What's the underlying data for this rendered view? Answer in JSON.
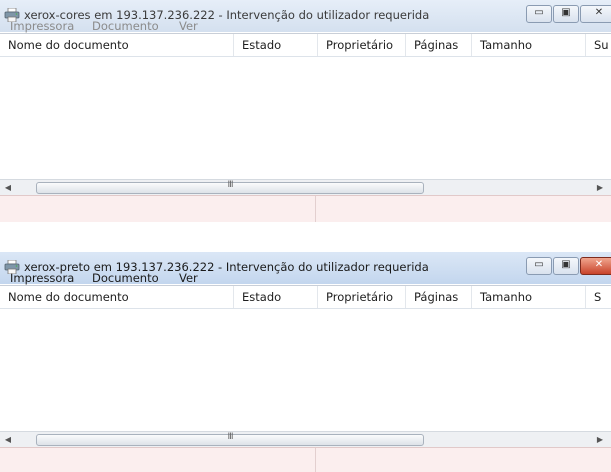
{
  "windows": [
    {
      "title": "xerox-cores em 193.137.236.222 - Intervenção do utilizador requerida",
      "menu": [
        "Impressora",
        "Documento",
        "Ver"
      ],
      "columns": [
        "Nome do documento",
        "Estado",
        "Proprietário",
        "Páginas",
        "Tamanho",
        "Su"
      ],
      "scroll_grip": "III",
      "controls": {
        "minimize": "▭",
        "maximize": "▣",
        "close": "✕"
      },
      "focused": false
    },
    {
      "title": "xerox-preto em 193.137.236.222 - Intervenção do utilizador requerida",
      "menu": [
        "Impressora",
        "Documento",
        "Ver"
      ],
      "columns": [
        "Nome do documento",
        "Estado",
        "Proprietário",
        "Páginas",
        "Tamanho",
        "S"
      ],
      "scroll_grip": "III",
      "controls": {
        "minimize": "▭",
        "maximize": "▣",
        "close": "✕"
      },
      "focused": true
    }
  ],
  "icons": {
    "printer": "printer-icon",
    "scroll_left": "◀",
    "scroll_right": "▶"
  },
  "colors": {
    "status_bar": "#fbeeee",
    "close_active": "#c8432a",
    "titlebar": "#d4e0ef"
  }
}
